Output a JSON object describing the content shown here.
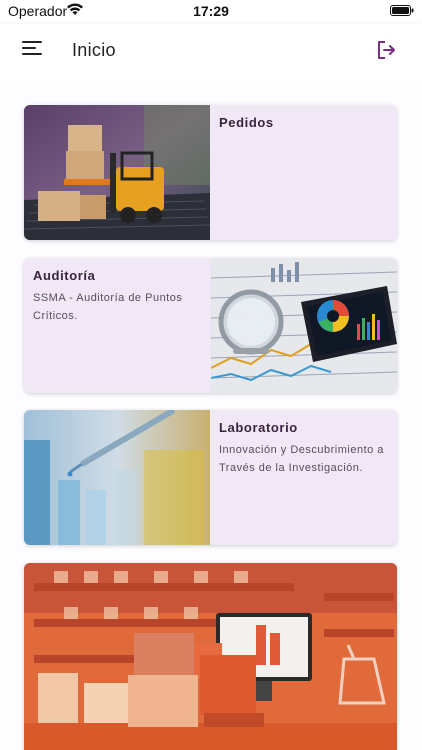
{
  "status": {
    "carrier": "Operador",
    "time": "17:29"
  },
  "header": {
    "title": "Inicio",
    "menu_icon": "menu-icon",
    "logout_icon": "logout-icon",
    "accent": "#7b2c86"
  },
  "cards": [
    {
      "title": "Pedidos",
      "description": "",
      "image": "forklift-laptop-image"
    },
    {
      "title": "Auditoría",
      "description": "SSMA - Auditoría de Puntos Críticos.",
      "image": "magnifier-charts-image"
    },
    {
      "title": "Laboratorio",
      "description": "Innovación y Descubrimiento a Través de la Investigación.",
      "image": "lab-pipette-image"
    },
    {
      "title": "",
      "description": "",
      "image": "warehouse-boxes-image"
    }
  ],
  "colors": {
    "card_bg": "#f1e8f6",
    "title": "#3b2440"
  }
}
